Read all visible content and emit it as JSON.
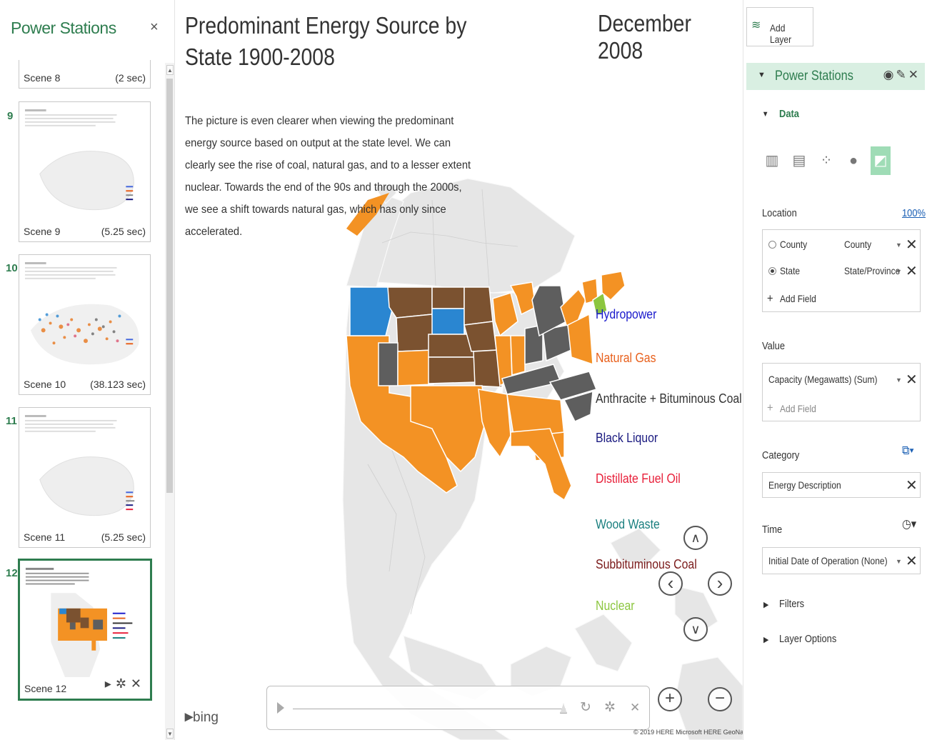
{
  "left_panel": {
    "title": "Power Stations",
    "close": "×",
    "scenes": [
      {
        "number": "",
        "label": "Scene 8",
        "duration": "(2 sec)"
      },
      {
        "number": "9",
        "label": "Scene 9",
        "duration": "(5.25 sec)"
      },
      {
        "number": "10",
        "label": "Scene 10",
        "duration": "(38.123 sec)"
      },
      {
        "number": "11",
        "label": "Scene 11",
        "duration": "(5.25 sec)"
      },
      {
        "number": "12",
        "label": "Scene 12",
        "duration": ""
      }
    ]
  },
  "map": {
    "title": "Predominant Energy Source by State 1900-2008",
    "date": "December 2008",
    "description": "The picture is even clearer when viewing the predominant energy source based on output at the state level.  We can clearly see the rise of coal, natural gas, and to a lesser extent nuclear.  Towards the end of the 90s and through the 2000s, we see a shift towards natural gas, which has only since accelerated.",
    "legend": [
      {
        "label": "Hydropower",
        "color": "#1a1acc"
      },
      {
        "label": "Natural Gas",
        "color": "#e8601c"
      },
      {
        "label": "Anthracite + Bituminous Coal",
        "color": "#333333"
      },
      {
        "label": "Black Liquor",
        "color": "#1a1a80"
      },
      {
        "label": "Distillate Fuel Oil",
        "color": "#e8203a"
      },
      {
        "label": "Wood Waste",
        "color": "#1a7f7f"
      },
      {
        "label": "Subbituminous Coal",
        "color": "#7a1a1a"
      },
      {
        "label": "Nuclear",
        "color": "#8cc63f"
      }
    ],
    "state_colors": {
      "hydropower": "#2a86d1",
      "natural_gas": "#f39224",
      "coal": "#5e5e5e",
      "subbituminous": "#7b5230",
      "nuclear": "#8cc63f",
      "land": "#e6e6e6"
    },
    "provider": "bing",
    "copyright": "© 2019 HERE Microsoft HERE GeoNames"
  },
  "controls": {
    "up": "∧",
    "left": "‹",
    "right": "›",
    "down": "∨",
    "zoom_in": "+",
    "zoom_out": "−"
  },
  "right_panel": {
    "add_layer": "Add Layer",
    "layer_name": "Power Stations",
    "data_section": "Data",
    "location_label": "Location",
    "location_pct": "100%",
    "location_fields": [
      {
        "name": "County",
        "type": "County",
        "selected": false
      },
      {
        "name": "State",
        "type": "State/Province",
        "selected": true
      }
    ],
    "add_field": "Add Field",
    "value_label": "Value",
    "value_field": "Capacity (Megawatts) (Sum)",
    "category_label": "Category",
    "category_field": "Energy Description",
    "time_label": "Time",
    "time_field": "Initial Date of Operation (None)",
    "filters": "Filters",
    "layer_options": "Layer Options"
  }
}
